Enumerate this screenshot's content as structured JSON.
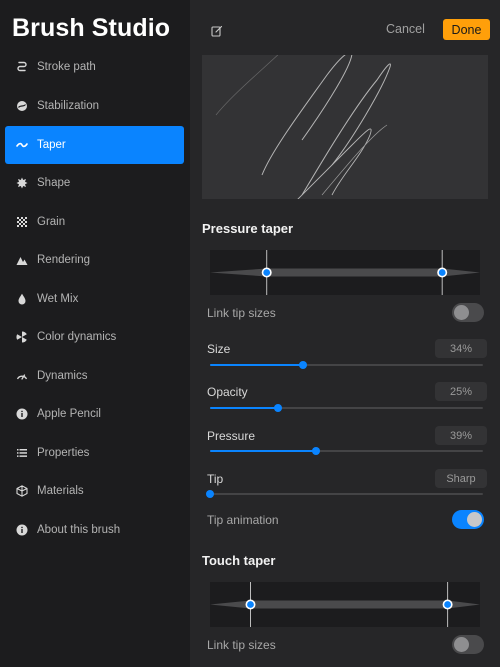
{
  "sidebar": {
    "title": "Brush Studio",
    "items": [
      {
        "label": "Stroke path",
        "icon": "stroke-path-icon",
        "active": false
      },
      {
        "label": "Stabilization",
        "icon": "stabilization-icon",
        "active": false
      },
      {
        "label": "Taper",
        "icon": "taper-icon",
        "active": true
      },
      {
        "label": "Shape",
        "icon": "shape-icon",
        "active": false
      },
      {
        "label": "Grain",
        "icon": "grain-icon",
        "active": false
      },
      {
        "label": "Rendering",
        "icon": "rendering-icon",
        "active": false
      },
      {
        "label": "Wet Mix",
        "icon": "wet-mix-icon",
        "active": false
      },
      {
        "label": "Color dynamics",
        "icon": "color-dynamics-icon",
        "active": false
      },
      {
        "label": "Dynamics",
        "icon": "dynamics-icon",
        "active": false
      },
      {
        "label": "Apple Pencil",
        "icon": "apple-pencil-icon",
        "active": false
      },
      {
        "label": "Properties",
        "icon": "properties-icon",
        "active": false
      },
      {
        "label": "Materials",
        "icon": "materials-icon",
        "active": false
      },
      {
        "label": "About this brush",
        "icon": "about-icon",
        "active": false
      }
    ]
  },
  "header": {
    "edit_icon": "edit-icon",
    "cancel_label": "Cancel",
    "done_label": "Done"
  },
  "pressure_taper": {
    "title": "Pressure taper",
    "start_handle": 0.21,
    "end_handle": 0.86,
    "link_tip_sizes_label": "Link tip sizes",
    "link_tip_sizes_on": false,
    "size": {
      "label": "Size",
      "value": "34%",
      "fraction": 0.34
    },
    "opacity": {
      "label": "Opacity",
      "value": "25%",
      "fraction": 0.25
    },
    "pressure": {
      "label": "Pressure",
      "value": "39%",
      "fraction": 0.39
    },
    "tip": {
      "label": "Tip",
      "value": "Sharp",
      "fraction": 0.0
    },
    "tip_animation_label": "Tip animation",
    "tip_animation_on": true
  },
  "touch_taper": {
    "title": "Touch taper",
    "start_handle": 0.15,
    "end_handle": 0.88,
    "link_tip_sizes_label": "Link tip sizes",
    "link_tip_sizes_on": false
  },
  "colors": {
    "accent": "#0a84ff",
    "done": "#ff9f0a",
    "sidebar_bg": "#1c1c1e",
    "panel_bg": "#262628"
  }
}
